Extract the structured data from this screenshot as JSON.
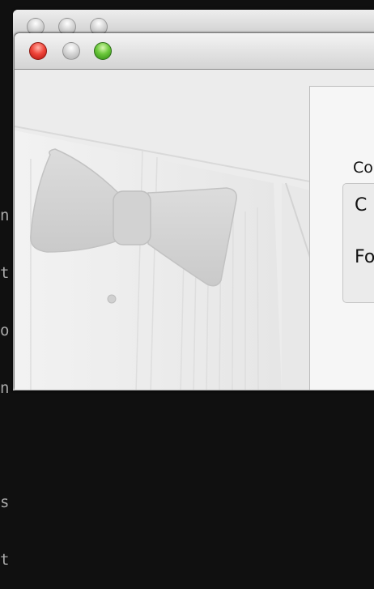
{
  "terminal": {
    "lines": [
      "n",
      "t",
      "o",
      "n",
      "",
      "s",
      "t"
    ]
  },
  "back_window": {
    "traffic_lights": [
      "close-icon",
      "minimize-icon",
      "zoom-icon"
    ]
  },
  "front_window": {
    "traffic_lights": [
      "close-icon",
      "minimize-icon",
      "zoom-icon"
    ],
    "colors": {
      "close": "#f0463b",
      "minimize": "#d6d6d6",
      "zoom": "#6cc83c"
    },
    "artwork": "bow-tie-tuxedo",
    "panel": {
      "heading": "Co",
      "items": [
        "C",
        "Fo"
      ]
    }
  }
}
